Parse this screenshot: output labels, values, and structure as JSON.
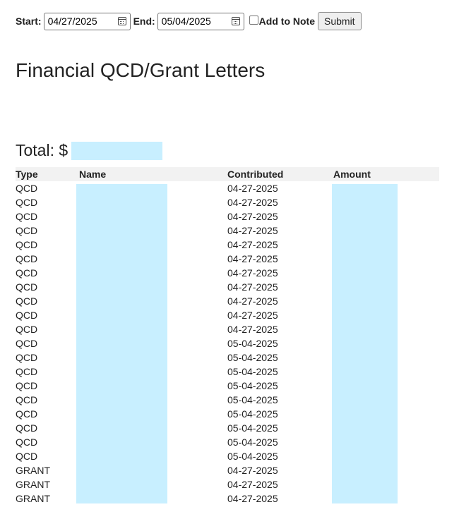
{
  "filters": {
    "start_label": "Start:",
    "start_value": "04/27/2025",
    "end_label": "End:",
    "end_value": "05/04/2025",
    "add_to_note_label": "Add to Note",
    "add_to_note_checked": false,
    "submit_label": "Submit"
  },
  "page": {
    "title": "Financial QCD/Grant Letters",
    "total_prefix": "Total: $"
  },
  "table": {
    "headers": [
      "Type",
      "Name",
      "Contributed",
      "Amount"
    ],
    "rows": [
      {
        "type": "QCD",
        "contributed": "04-27-2025"
      },
      {
        "type": "QCD",
        "contributed": "04-27-2025"
      },
      {
        "type": "QCD",
        "contributed": "04-27-2025"
      },
      {
        "type": "QCD",
        "contributed": "04-27-2025"
      },
      {
        "type": "QCD",
        "contributed": "04-27-2025"
      },
      {
        "type": "QCD",
        "contributed": "04-27-2025"
      },
      {
        "type": "QCD",
        "contributed": "04-27-2025"
      },
      {
        "type": "QCD",
        "contributed": "04-27-2025"
      },
      {
        "type": "QCD",
        "contributed": "04-27-2025"
      },
      {
        "type": "QCD",
        "contributed": "04-27-2025"
      },
      {
        "type": "QCD",
        "contributed": "04-27-2025"
      },
      {
        "type": "QCD",
        "contributed": "05-04-2025"
      },
      {
        "type": "QCD",
        "contributed": "05-04-2025"
      },
      {
        "type": "QCD",
        "contributed": "05-04-2025"
      },
      {
        "type": "QCD",
        "contributed": "05-04-2025"
      },
      {
        "type": "QCD",
        "contributed": "05-04-2025"
      },
      {
        "type": "QCD",
        "contributed": "05-04-2025"
      },
      {
        "type": "QCD",
        "contributed": "05-04-2025"
      },
      {
        "type": "QCD",
        "contributed": "05-04-2025"
      },
      {
        "type": "QCD",
        "contributed": "05-04-2025"
      },
      {
        "type": "GRANT",
        "contributed": "04-27-2025"
      },
      {
        "type": "GRANT",
        "contributed": "04-27-2025"
      },
      {
        "type": "GRANT",
        "contributed": "04-27-2025"
      }
    ]
  },
  "colors": {
    "redaction": "#c8efff",
    "header_bg": "#f2f2f2"
  }
}
